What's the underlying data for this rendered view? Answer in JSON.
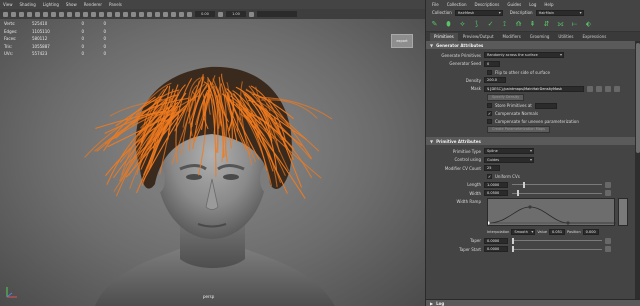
{
  "viewport": {
    "menu": [
      "View",
      "Shading",
      "Lighting",
      "Show",
      "Renderer",
      "Panels"
    ],
    "toolbar": {
      "field_a": "0.00",
      "field_b": "1.00"
    },
    "hud": [
      {
        "label": "Verts:",
        "value": "525410",
        "z1": "0",
        "z2": "0"
      },
      {
        "label": "Edges:",
        "value": "1105110",
        "z1": "0",
        "z2": "0"
      },
      {
        "label": "Faces:",
        "value": "580112",
        "z1": "0",
        "z2": "0"
      },
      {
        "label": "Tris:",
        "value": "1055887",
        "z1": "0",
        "z2": "0"
      },
      {
        "label": "UVs:",
        "value": "557423",
        "z1": "0",
        "z2": "0"
      }
    ],
    "persp_button": "export",
    "camera_label": "persp",
    "hair_color": "#f07a1e",
    "head_color": "#9a9a9a"
  },
  "ae": {
    "menu": [
      "File",
      "Collection",
      "Descriptions",
      "Guides",
      "Log",
      "Help"
    ],
    "collection_label": "Collection",
    "collection_value": "HairMesh",
    "description_label": "Description",
    "description_value": "HairMain",
    "tabs": [
      "Primitives",
      "Preview/Output",
      "Modifiers",
      "Grooming",
      "Utilities",
      "Expressions"
    ],
    "active_tab": "Primitives",
    "section1": {
      "title": "Generator Attributes",
      "generate_primitives_label": "Generate Primitives",
      "generate_primitives_value": "Randomly across the surface",
      "generator_seed_label": "Generator Seed",
      "generator_seed_value": "0",
      "flip_label": "Flip to other side of surface",
      "density_label": "Density",
      "density_value": "200.0",
      "mask_label": "Mask",
      "mask_value": "${DESC}/paintmaps/MainHairDensityMask",
      "specify_btn": "Specify Density",
      "store_label": "Store Primitives at",
      "compensate_label": "Compensate Normals",
      "uneven_label": "Compensate for uneven parameterization",
      "create_btn": "Create Parameterization Maps"
    },
    "section2": {
      "title": "Primitive Attributes",
      "type_label": "Primitive Type",
      "type_value": "Spline",
      "control_label": "Control using",
      "control_value": "Guides",
      "cv_label": "Modifier CV Count",
      "cv_value": "25",
      "uniform_label": "Uniform CVs",
      "length_label": "Length",
      "length_value": "1.0000",
      "length_level": 0.12,
      "width_label": "Width",
      "width_value": "0.0500",
      "width_level": 0.05,
      "ramp_label": "Width Ramp",
      "interp_label": "Interpolation",
      "interp_value": "Smooth",
      "value_label": "Value",
      "value_value": "0.051",
      "position_label": "Position",
      "position_value": "0.000",
      "taper_label": "Taper",
      "taper_value": "0.0000",
      "taper_level": 0.0,
      "taper_start_label": "Taper Start",
      "taper_start_value": "0.0000",
      "taper_start_level": 0.0
    },
    "bottom_section": "Log"
  }
}
